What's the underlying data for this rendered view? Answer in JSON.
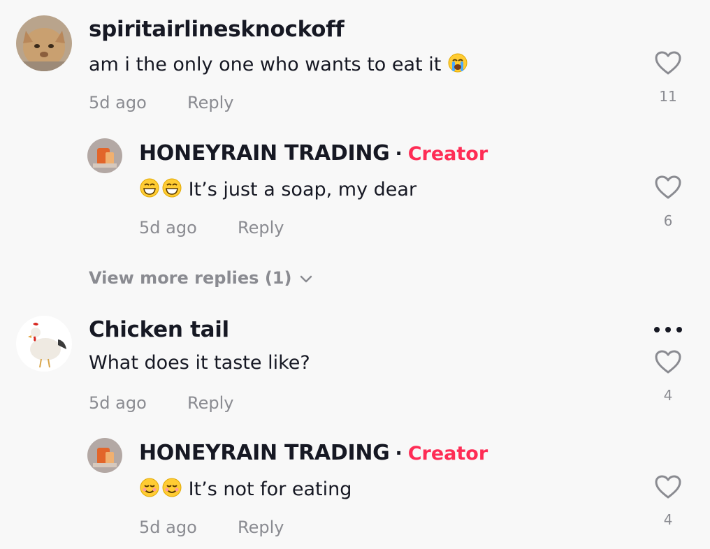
{
  "comments": [
    {
      "username": "spiritairlinesknockoff",
      "text": "am i the only one who wants to eat it",
      "time": "5d ago",
      "reply_label": "Reply",
      "likes": "11",
      "avatar_icon": "cat-avatar",
      "emoji_icon": "loudly-crying-face-icon"
    },
    {
      "username": "Chicken tail",
      "text": "What does it taste like?",
      "time": "5d ago",
      "reply_label": "Reply",
      "likes": "4",
      "avatar_icon": "chicken-avatar",
      "more_icon": "more-options-icon"
    }
  ],
  "replies": [
    {
      "username": "HONEYRAIN TRADING",
      "separator": "·",
      "badge": "Creator",
      "text": "It’s just a soap, my dear",
      "time": "5d ago",
      "reply_label": "Reply",
      "likes": "6",
      "emoji_icon": "grinning-face-icon"
    },
    {
      "username": "HONEYRAIN TRADING",
      "separator": "·",
      "badge": "Creator",
      "text": "It’s not for eating",
      "time": "5d ago",
      "reply_label": "Reply",
      "likes": "4",
      "emoji_icon": "smiling-face-icon"
    }
  ],
  "view_more": {
    "label": "View more replies (1)"
  },
  "colors": {
    "background": "#f8f8f8",
    "text": "#161823",
    "muted": "#8a8b91",
    "creator": "#fe2c55"
  }
}
